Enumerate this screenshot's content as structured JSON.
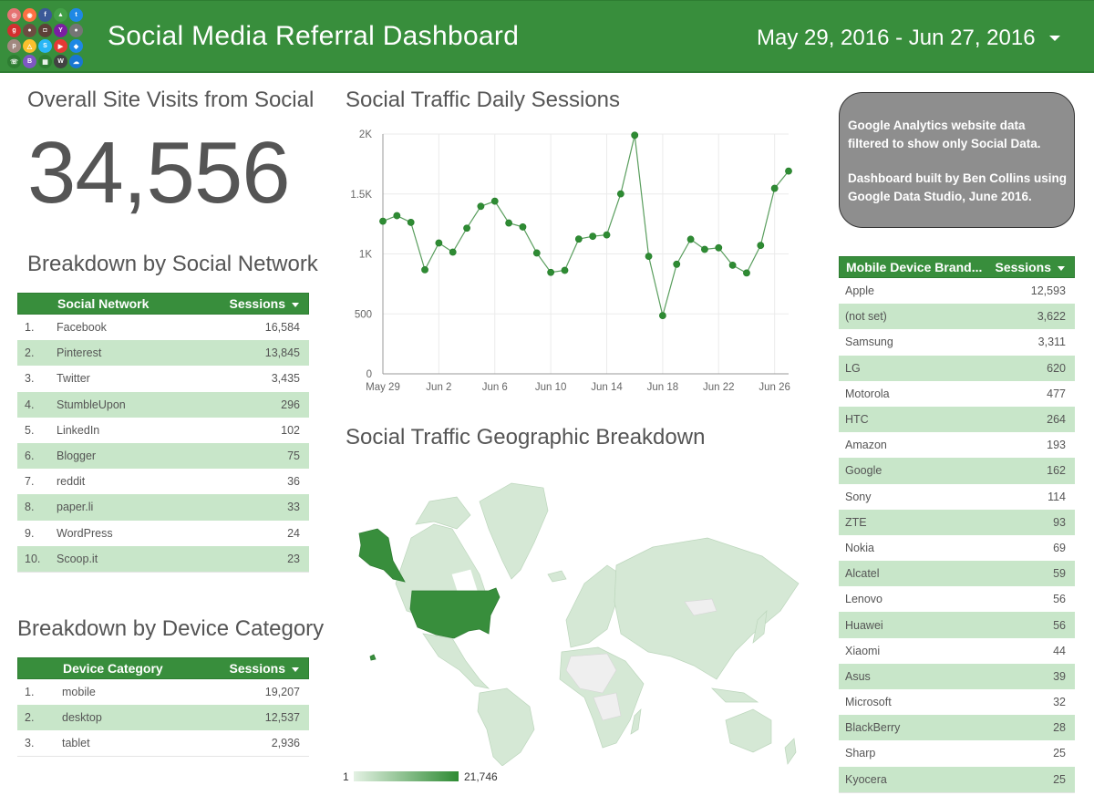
{
  "header": {
    "title": "Social Media Referral Dashboard",
    "date_range": "May 29, 2016 - Jun 27, 2016",
    "logo_icons": [
      {
        "name": "instagram-icon",
        "color": "#e57373",
        "glyph": "◎"
      },
      {
        "name": "rss-icon",
        "color": "#ff7043",
        "glyph": "◉"
      },
      {
        "name": "facebook-icon",
        "color": "#3b5998",
        "glyph": "f"
      },
      {
        "name": "android-icon",
        "color": "#43a047",
        "glyph": "▲"
      },
      {
        "name": "twitter-icon",
        "color": "#1e88e5",
        "glyph": "t"
      },
      {
        "name": "google-plus-icon",
        "color": "#d32f2f",
        "glyph": "g"
      },
      {
        "name": "camera-icon",
        "color": "#6d4c41",
        "glyph": "●"
      },
      {
        "name": "flickr-icon",
        "color": "#5d4037",
        "glyph": "◘"
      },
      {
        "name": "yahoo-icon",
        "color": "#7b1fa2",
        "glyph": "Y"
      },
      {
        "name": "apple-icon",
        "color": "#757575",
        "glyph": "●"
      },
      {
        "name": "pinterest-icon",
        "color": "#a1887f",
        "glyph": "p"
      },
      {
        "name": "google-drive-icon",
        "color": "#fbc02d",
        "glyph": "△"
      },
      {
        "name": "skype-icon",
        "color": "#29b6f6",
        "glyph": "S"
      },
      {
        "name": "youtube-icon",
        "color": "#e53935",
        "glyph": "▶"
      },
      {
        "name": "dropbox-icon",
        "color": "#1e88e5",
        "glyph": "◆"
      },
      {
        "name": "whatsapp-icon",
        "color": "#2e7d32",
        "glyph": "☏"
      },
      {
        "name": "blogger-icon",
        "color": "#7e57c2",
        "glyph": "B"
      },
      {
        "name": "windows-icon",
        "color": "#2e7d32",
        "glyph": "▦"
      },
      {
        "name": "wordpress-icon",
        "color": "#424242",
        "glyph": "W"
      },
      {
        "name": "soundcloud-icon",
        "color": "#1976d2",
        "glyph": "☁"
      }
    ]
  },
  "overall": {
    "title": "Overall Site Visits from Social",
    "value": "34,556"
  },
  "social_network": {
    "title": "Breakdown by Social Network",
    "columns": [
      "Social Network",
      "Sessions"
    ],
    "rows": [
      {
        "idx": "1.",
        "name": "Facebook",
        "value": "16,584"
      },
      {
        "idx": "2.",
        "name": "Pinterest",
        "value": "13,845"
      },
      {
        "idx": "3.",
        "name": "Twitter",
        "value": "3,435"
      },
      {
        "idx": "4.",
        "name": "StumbleUpon",
        "value": "296"
      },
      {
        "idx": "5.",
        "name": "LinkedIn",
        "value": "102"
      },
      {
        "idx": "6.",
        "name": "Blogger",
        "value": "75"
      },
      {
        "idx": "7.",
        "name": "reddit",
        "value": "36"
      },
      {
        "idx": "8.",
        "name": "paper.li",
        "value": "33"
      },
      {
        "idx": "9.",
        "name": "WordPress",
        "value": "24"
      },
      {
        "idx": "10.",
        "name": "Scoop.it",
        "value": "23"
      }
    ]
  },
  "device_category": {
    "title": "Breakdown by Device Category",
    "columns": [
      "Device Category",
      "Sessions"
    ],
    "rows": [
      {
        "idx": "1.",
        "name": "mobile",
        "value": "19,207"
      },
      {
        "idx": "2.",
        "name": "desktop",
        "value": "12,537"
      },
      {
        "idx": "3.",
        "name": "tablet",
        "value": "2,936"
      }
    ]
  },
  "daily_sessions": {
    "title": "Social Traffic Daily Sessions"
  },
  "chart_data": {
    "type": "line",
    "title": "Social Traffic Daily Sessions",
    "xlabel": "",
    "ylabel": "",
    "x": [
      "May 29",
      "May 30",
      "May 31",
      "Jun 1",
      "Jun 2",
      "Jun 3",
      "Jun 4",
      "Jun 5",
      "Jun 6",
      "Jun 7",
      "Jun 8",
      "Jun 9",
      "Jun 10",
      "Jun 11",
      "Jun 12",
      "Jun 13",
      "Jun 14",
      "Jun 15",
      "Jun 16",
      "Jun 17",
      "Jun 18",
      "Jun 19",
      "Jun 20",
      "Jun 21",
      "Jun 22",
      "Jun 23",
      "Jun 24",
      "Jun 25",
      "Jun 26",
      "Jun 27"
    ],
    "series": [
      {
        "name": "Sessions",
        "color": "#2e8b33",
        "values": [
          1273,
          1319,
          1263,
          868,
          1091,
          1015,
          1215,
          1397,
          1440,
          1258,
          1225,
          1008,
          846,
          863,
          1124,
          1147,
          1159,
          1501,
          1990,
          980,
          486,
          914,
          1122,
          1038,
          1051,
          906,
          841,
          1071,
          1547,
          1691
        ]
      }
    ],
    "x_tick_labels": [
      "May 29",
      "Jun 2",
      "Jun 6",
      "Jun 10",
      "Jun 14",
      "Jun 18",
      "Jun 22",
      "Jun 26"
    ],
    "x_tick_indices": [
      0,
      4,
      8,
      12,
      16,
      20,
      24,
      28
    ],
    "y_ticks": [
      0,
      500,
      1000,
      1500,
      2000
    ],
    "y_tick_labels": [
      "0",
      "500",
      "1K",
      "1.5K",
      "2K"
    ],
    "ylim": [
      0,
      2000
    ],
    "grid": true,
    "legend": "none"
  },
  "geo": {
    "title": "Social Traffic Geographic Breakdown",
    "legend_min": "1",
    "legend_max": "21,746",
    "color_low": "#e3f1e3",
    "color_high": "#2e8b33",
    "highlight_country": "United States"
  },
  "info_box": {
    "line1": "Google Analytics website data filtered to show only Social Data.",
    "line2": "Dashboard built by Ben Collins using Google Data Studio, June 2016."
  },
  "mobile_brand": {
    "columns": [
      "Mobile Device Brand...",
      "Sessions"
    ],
    "rows": [
      {
        "name": "Apple",
        "value": "12,593"
      },
      {
        "name": "(not set)",
        "value": "3,622"
      },
      {
        "name": "Samsung",
        "value": "3,311"
      },
      {
        "name": "LG",
        "value": "620"
      },
      {
        "name": "Motorola",
        "value": "477"
      },
      {
        "name": "HTC",
        "value": "264"
      },
      {
        "name": "Amazon",
        "value": "193"
      },
      {
        "name": "Google",
        "value": "162"
      },
      {
        "name": "Sony",
        "value": "114"
      },
      {
        "name": "ZTE",
        "value": "93"
      },
      {
        "name": "Nokia",
        "value": "69"
      },
      {
        "name": "Alcatel",
        "value": "59"
      },
      {
        "name": "Lenovo",
        "value": "56"
      },
      {
        "name": "Huawei",
        "value": "56"
      },
      {
        "name": "Xiaomi",
        "value": "44"
      },
      {
        "name": "Asus",
        "value": "39"
      },
      {
        "name": "Microsoft",
        "value": "32"
      },
      {
        "name": "BlackBerry",
        "value": "28"
      },
      {
        "name": "Sharp",
        "value": "25"
      },
      {
        "name": "Kyocera",
        "value": "25"
      }
    ]
  },
  "colors": {
    "brand_green": "#388e3c",
    "row_alt": "#c8e6c9",
    "info_box_bg": "#8e8e8e"
  }
}
